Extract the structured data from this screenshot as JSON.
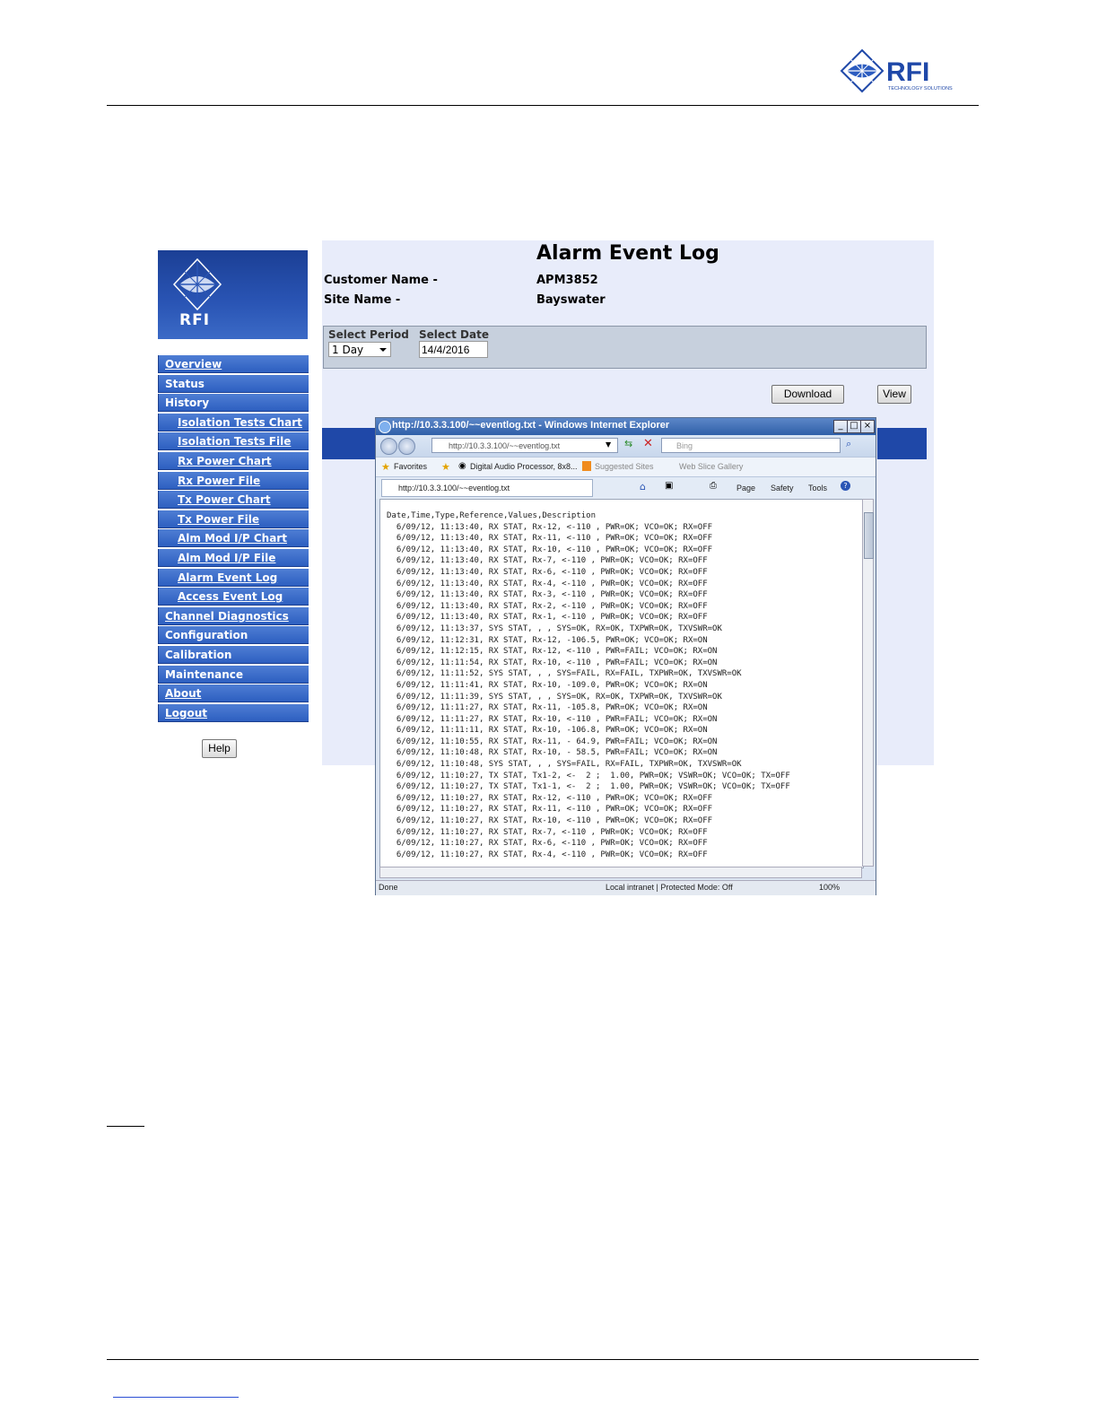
{
  "brand": {
    "name": "RFI",
    "tagline": "TECHNOLOGY SOLUTIONS",
    "accent_color": "#1f48a8"
  },
  "sidebar": {
    "logo_text": "RFI",
    "items": [
      {
        "label": "Overview"
      },
      {
        "label": "Status"
      },
      {
        "label": "History"
      },
      {
        "label": "Isolation Tests Chart"
      },
      {
        "label": "Isolation Tests File"
      },
      {
        "label": "Rx Power Chart"
      },
      {
        "label": "Rx Power File"
      },
      {
        "label": "Tx Power Chart"
      },
      {
        "label": "Tx Power File"
      },
      {
        "label": "Alm Mod I/P Chart"
      },
      {
        "label": "Alm Mod I/P File"
      },
      {
        "label": "Alarm Event Log"
      },
      {
        "label": "Access Event Log"
      },
      {
        "label": "Channel Diagnostics"
      },
      {
        "label": "Configuration"
      },
      {
        "label": "Calibration"
      },
      {
        "label": "Maintenance"
      },
      {
        "label": "About"
      },
      {
        "label": "Logout"
      }
    ],
    "help_label": "Help"
  },
  "main": {
    "title": "Alarm Event Log",
    "customer_label": "Customer Name -",
    "customer_value": "APM3852",
    "site_label": "Site Name -",
    "site_value": "Bayswater",
    "period_label": "Select Period",
    "period_value": "1 Day",
    "date_label": "Select Date",
    "date_value": "14/4/2016",
    "download_label": "Download",
    "view_label": "View"
  },
  "ie": {
    "title": "http://10.3.3.100/~~eventlog.txt - Windows Internet Explorer",
    "address": "http://10.3.3.100/~~eventlog.txt",
    "search_placeholder": "Bing",
    "favorites_label": "Favorites",
    "fav_item_1": "Digital Audio Processor, 8x8...",
    "fav_item_2": "Suggested Sites",
    "fav_item_3": "Web Slice Gallery",
    "tab_label": "http://10.3.3.100/~~eventlog.txt",
    "cmd_page": "Page",
    "cmd_safety": "Safety",
    "cmd_tools": "Tools",
    "status_left": "Done",
    "status_zone": "Local intranet | Protected Mode: Off",
    "status_zoom": "100%",
    "window_controls": [
      "minimize-icon",
      "maximize-icon",
      "close-icon"
    ]
  },
  "log": {
    "lines": [
      "Date,Time,Type,Reference,Values,Description",
      "  6/09/12, 11:13:40, RX STAT, Rx-12, <-110 , PWR=OK; VCO=OK; RX=OFF",
      "  6/09/12, 11:13:40, RX STAT, Rx-11, <-110 , PWR=OK; VCO=OK; RX=OFF",
      "  6/09/12, 11:13:40, RX STAT, Rx-10, <-110 , PWR=OK; VCO=OK; RX=OFF",
      "  6/09/12, 11:13:40, RX STAT, Rx-7, <-110 , PWR=OK; VCO=OK; RX=OFF",
      "  6/09/12, 11:13:40, RX STAT, Rx-6, <-110 , PWR=OK; VCO=OK; RX=OFF",
      "  6/09/12, 11:13:40, RX STAT, Rx-4, <-110 , PWR=OK; VCO=OK; RX=OFF",
      "  6/09/12, 11:13:40, RX STAT, Rx-3, <-110 , PWR=OK; VCO=OK; RX=OFF",
      "  6/09/12, 11:13:40, RX STAT, Rx-2, <-110 , PWR=OK; VCO=OK; RX=OFF",
      "  6/09/12, 11:13:40, RX STAT, Rx-1, <-110 , PWR=OK; VCO=OK; RX=OFF",
      "  6/09/12, 11:13:37, SYS STAT, , , SYS=OK, RX=OK, TXPWR=OK, TXVSWR=OK",
      "  6/09/12, 11:12:31, RX STAT, Rx-12, -106.5, PWR=OK; VCO=OK; RX=ON",
      "  6/09/12, 11:12:15, RX STAT, Rx-12, <-110 , PWR=FAIL; VCO=OK; RX=ON",
      "  6/09/12, 11:11:54, RX STAT, Rx-10, <-110 , PWR=FAIL; VCO=OK; RX=ON",
      "  6/09/12, 11:11:52, SYS STAT, , , SYS=FAIL, RX=FAIL, TXPWR=OK, TXVSWR=OK",
      "  6/09/12, 11:11:41, RX STAT, Rx-10, -109.0, PWR=OK; VCO=OK; RX=ON",
      "  6/09/12, 11:11:39, SYS STAT, , , SYS=OK, RX=OK, TXPWR=OK, TXVSWR=OK",
      "  6/09/12, 11:11:27, RX STAT, Rx-11, -105.8, PWR=OK; VCO=OK; RX=ON",
      "  6/09/12, 11:11:27, RX STAT, Rx-10, <-110 , PWR=FAIL; VCO=OK; RX=ON",
      "  6/09/12, 11:11:11, RX STAT, Rx-10, -106.8, PWR=OK; VCO=OK; RX=ON",
      "  6/09/12, 11:10:55, RX STAT, Rx-11, - 64.9, PWR=FAIL; VCO=OK; RX=ON",
      "  6/09/12, 11:10:48, RX STAT, Rx-10, - 58.5, PWR=FAIL; VCO=OK; RX=ON",
      "  6/09/12, 11:10:48, SYS STAT, , , SYS=FAIL, RX=FAIL, TXPWR=OK, TXVSWR=OK",
      "  6/09/12, 11:10:27, TX STAT, Tx1-2, <-  2 ;  1.00, PWR=OK; VSWR=OK; VCO=OK; TX=OFF",
      "  6/09/12, 11:10:27, TX STAT, Tx1-1, <-  2 ;  1.00, PWR=OK; VSWR=OK; VCO=OK; TX=OFF",
      "  6/09/12, 11:10:27, RX STAT, Rx-12, <-110 , PWR=OK; VCO=OK; RX=OFF",
      "  6/09/12, 11:10:27, RX STAT, Rx-11, <-110 , PWR=OK; VCO=OK; RX=OFF",
      "  6/09/12, 11:10:27, RX STAT, Rx-10, <-110 , PWR=OK; VCO=OK; RX=OFF",
      "  6/09/12, 11:10:27, RX STAT, Rx-7, <-110 , PWR=OK; VCO=OK; RX=OFF",
      "  6/09/12, 11:10:27, RX STAT, Rx-6, <-110 , PWR=OK; VCO=OK; RX=OFF",
      "  6/09/12, 11:10:27, RX STAT, Rx-4, <-110 , PWR=OK; VCO=OK; RX=OFF"
    ]
  }
}
